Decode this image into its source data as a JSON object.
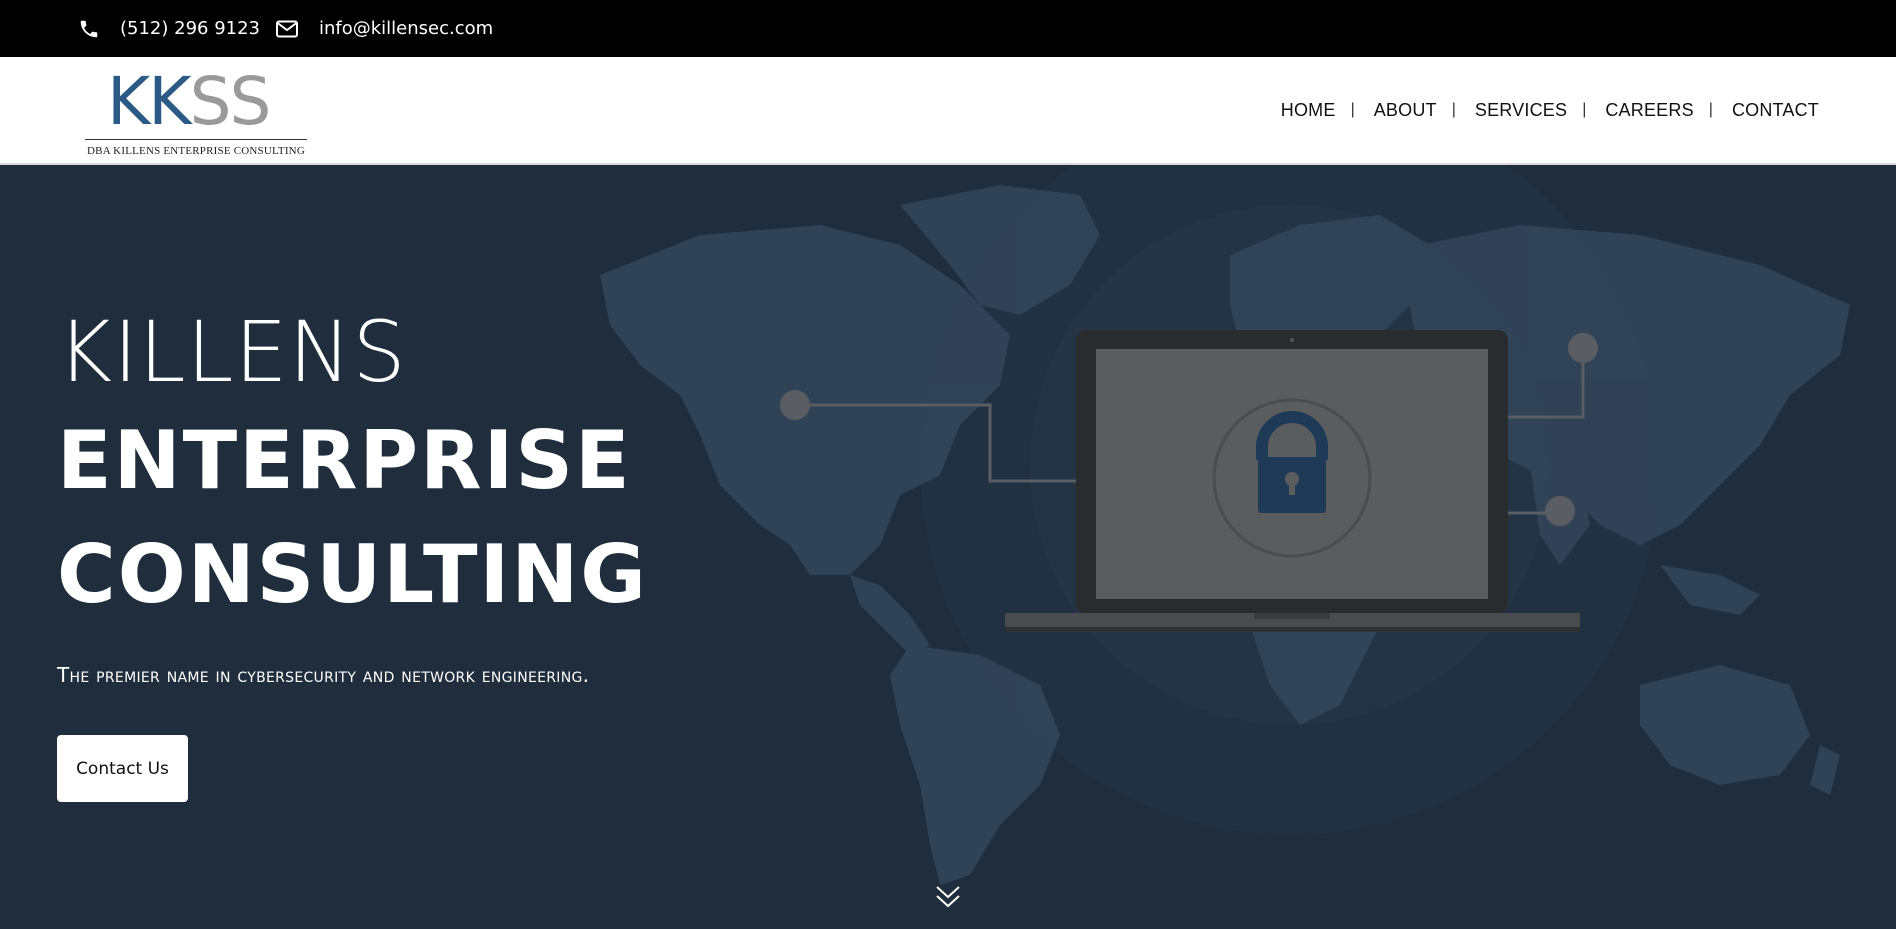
{
  "topbar": {
    "phone": "(512) 296 9123",
    "email": "info@killensec.com"
  },
  "logo": {
    "letters_primary": "KK",
    "letters_secondary": "SS",
    "tagline": "DBA KILLENS ENTERPRISE CONSULTING"
  },
  "nav": {
    "items": [
      {
        "label": "HOME"
      },
      {
        "label": "ABOUT"
      },
      {
        "label": "SERVICES"
      },
      {
        "label": "CAREERS"
      },
      {
        "label": "CONTACT"
      }
    ],
    "separator": "|"
  },
  "hero": {
    "title_line1": "KILLENS",
    "title_line2": "ENTERPRISE",
    "title_line3": "CONSULTING",
    "tagline": "The premier name in cybersecurity and network engineering.",
    "cta_label": "Contact Us"
  },
  "icons": {
    "phone": "phone-icon",
    "email": "envelope-icon",
    "scroll": "chevron-double-down-icon"
  },
  "colors": {
    "hero_bg": "#1f2d3d",
    "logo_blue": "#2a5a85",
    "logo_grey": "#9a9a9a",
    "topbar_bg": "#000000"
  }
}
